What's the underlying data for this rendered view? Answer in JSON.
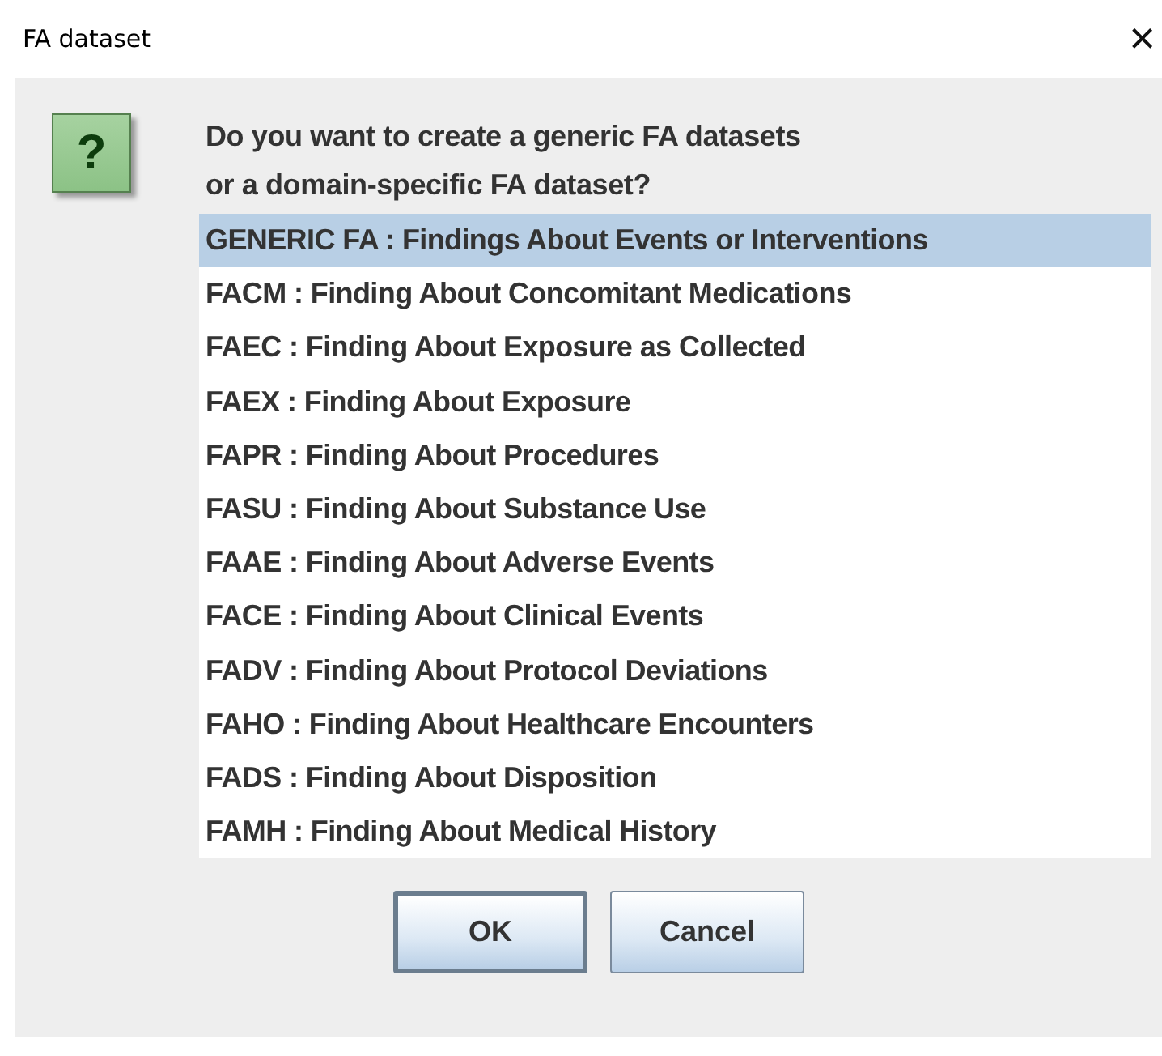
{
  "window": {
    "title": "FA dataset",
    "close": "×"
  },
  "message": [
    "Do you want to create a generic FA datasets",
    "or a domain-specific FA dataset?"
  ],
  "icon": "?",
  "options": [
    {
      "label": "GENERIC FA : Findings About Events or Interventions",
      "selected": true
    },
    {
      "label": "FACM : Finding About Concomitant Medications",
      "selected": false
    },
    {
      "label": "FAEC : Finding About Exposure as Collected",
      "selected": false
    },
    {
      "label": "FAEX : Finding About Exposure",
      "selected": false
    },
    {
      "label": "FAPR : Finding About Procedures",
      "selected": false
    },
    {
      "label": "FASU : Finding About Substance Use",
      "selected": false
    },
    {
      "label": "FAAE : Finding About Adverse Events",
      "selected": false
    },
    {
      "label": "FACE : Finding About Clinical Events",
      "selected": false
    },
    {
      "label": "FADV : Finding About Protocol Deviations",
      "selected": false
    },
    {
      "label": "FAHO : Finding About Healthcare Encounters",
      "selected": false
    },
    {
      "label": "FADS : Finding About Disposition",
      "selected": false
    },
    {
      "label": "FAMH : Finding About Medical History",
      "selected": false
    }
  ],
  "buttons": [
    {
      "label": "OK",
      "default": true
    },
    {
      "label": "Cancel",
      "default": false
    }
  ]
}
